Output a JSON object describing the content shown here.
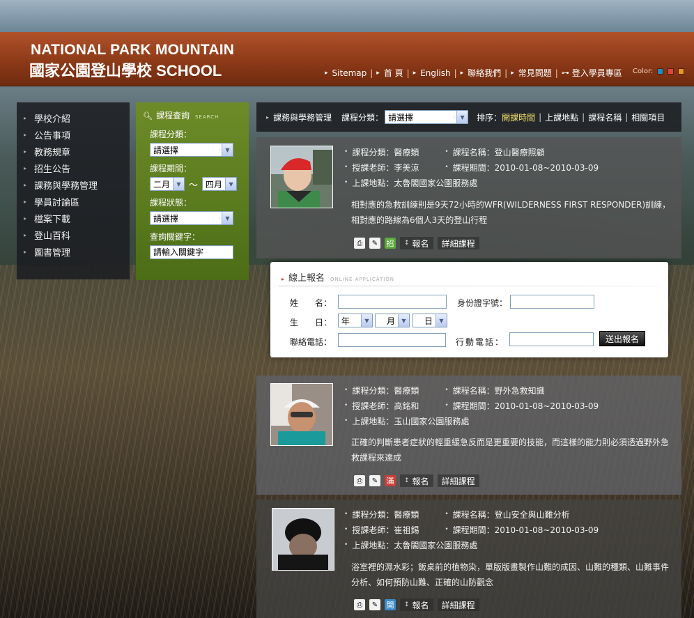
{
  "header": {
    "logo_en": "NATIONAL PARK MOUNTAIN",
    "logo_zh": "國家公園登山學校",
    "logo_zh_en": "SCHOOL",
    "nav": [
      {
        "label": "Sitemap",
        "icon": "arrow-right-icon"
      },
      {
        "label": "首 頁",
        "icon": "arrow-right-icon"
      },
      {
        "label": "English",
        "icon": "arrow-right-icon"
      },
      {
        "label": "聯絡我們",
        "icon": "arrow-right-icon"
      },
      {
        "label": "常見問題",
        "icon": "arrow-right-icon"
      },
      {
        "label": "登入學員專區",
        "icon": "key-icon"
      }
    ],
    "color_label": "Color:",
    "colors": [
      "#1e90c8",
      "#e0463a",
      "#e89a1a"
    ]
  },
  "leftmenu": {
    "items": [
      "學校介紹",
      "公告事項",
      "教務規章",
      "招生公告",
      "課務與學務管理",
      "學員討論區",
      "檔案下載",
      "登山百科",
      "圖書管理"
    ]
  },
  "search": {
    "title": "課程查詢",
    "title_en": "SEARCH",
    "category_label": "課程分類：",
    "category_value": "請選擇",
    "period_label": "課程期間：",
    "period_from": "二月",
    "period_sep": "〜",
    "period_to": "四月",
    "status_label": "課程狀態：",
    "status_value": "請選擇",
    "keyword_label": "查詢關鍵字：",
    "keyword_placeholder": "請輸入關鍵字"
  },
  "toolbar": {
    "section": "課務與學務管理",
    "category_label": "課程分類：",
    "category_value": "請選擇",
    "sort_label": "排序：",
    "sort_options": [
      "開課時間",
      "上課地點",
      "課程名稱",
      "相關項目"
    ],
    "sort_active": "開課時間"
  },
  "courses": [
    {
      "category": "課程分類：醫療類",
      "name": "課程名稱：登山醫療照顧",
      "teacher": "授課老師：李美涼",
      "period": "課程期間：2010-01-08~2010-03-09",
      "location": "上課地點：太魯閣國家公園服務處",
      "description": "相對應的急救訓練則是9天72小時的WFR(WILDERNESS FIRST RESPONDER)訓練，相對應的路線為6個人3天的登山行程",
      "status_badge": "招",
      "status_color": "#5aa83a",
      "signup_label": "報名",
      "detail_label": "詳細課程"
    },
    {
      "category": "課程分類：醫療類",
      "name": "課程名稱：野外急救知識",
      "teacher": "授課老師：高銘和",
      "period": "課程期間：2010-01-08~2010-03-09",
      "location": "上課地點：玉山國家公園服務處",
      "description": "正確的判斷患者症狀的輕重緩急反而是更重要的技能，而這樣的能力則必須透過野外急救課程來達成",
      "status_badge": "滿",
      "status_color": "#c8403a",
      "signup_label": "報名",
      "detail_label": "詳細課程"
    },
    {
      "category": "課程分類：醫療類",
      "name": "課程名稱：登山安全與山難分析",
      "teacher": "授課老師：崔祖錫",
      "period": "課程期間：2010-01-08~2010-03-09",
      "location": "上課地點：太魯閣國家公園服務處",
      "description": "浴室裡的濕水彩；飯桌前的植物染，單版版畫製作山難的成因、山難的種類、山難事件分析、如何預防山難、正確的山防觀念",
      "status_badge": "開",
      "status_color": "#3a8ac8",
      "signup_label": "報名",
      "detail_label": "詳細課程"
    }
  ],
  "form": {
    "title": "線上報名",
    "title_en": "ONLINE APPLICATION",
    "name_label": "姓　　名：",
    "id_label": "身份證字號：",
    "birth_label": "生　　日：",
    "year": "年",
    "month": "月",
    "day": "日",
    "phone_label": "聯絡電話：",
    "mobile_label": "行動電話：",
    "submit": "送出報名"
  }
}
